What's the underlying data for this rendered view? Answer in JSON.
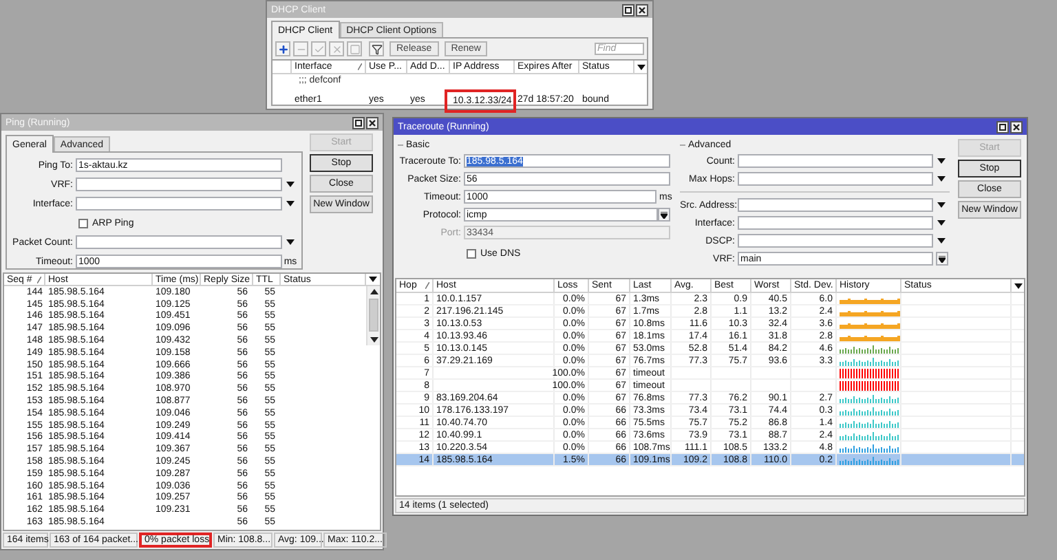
{
  "dhcp_window": {
    "title": "DHCP Client",
    "active": false,
    "tabs": [
      {
        "label": "DHCP Client",
        "selected": true
      },
      {
        "label": "DHCP Client Options",
        "selected": false
      }
    ],
    "toolbar": [
      {
        "kind": "add",
        "disabled": false
      },
      {
        "kind": "remove",
        "disabled": true
      },
      {
        "kind": "enable",
        "disabled": true
      },
      {
        "kind": "disable",
        "disabled": true
      },
      {
        "kind": "comment",
        "disabled": true
      },
      {
        "kind": "filter",
        "disabled": false
      }
    ],
    "actions": [
      {
        "label": "Release",
        "disabled": false
      },
      {
        "label": "Renew",
        "disabled": false
      }
    ],
    "find": {
      "placeholder": "Find"
    },
    "columns": [
      {
        "label": "Interface",
        "sorted": true
      },
      {
        "label": "Use P...",
        "sorted": false
      },
      {
        "label": "Add D...",
        "sorted": false
      },
      {
        "label": "IP Address",
        "sorted": false
      },
      {
        "label": "Expires After",
        "sorted": false
      },
      {
        "label": "Status",
        "sorted": false
      }
    ],
    "rows": [
      {
        "kind": "comment",
        "text": ";;; defconf"
      },
      {
        "kind": "entry",
        "cells": [
          {
            "text": "ether1",
            "highlighted": false
          },
          {
            "text": "yes",
            "highlighted": false
          },
          {
            "text": "yes",
            "highlighted": false
          },
          {
            "text": "10.3.12.33/24",
            "highlighted": true
          },
          {
            "text": "27d 18:57:20",
            "highlighted": false
          },
          {
            "text": "bound",
            "highlighted": false
          }
        ]
      }
    ]
  },
  "ping_window": {
    "title": "Ping (Running)",
    "active": false,
    "tabs": [
      {
        "label": "General",
        "selected": true
      },
      {
        "label": "Advanced",
        "selected": false
      }
    ],
    "form": [
      {
        "kind": "text",
        "label": "Ping To:",
        "value": "1s-aktau.kz"
      },
      {
        "kind": "dropdown",
        "label": "VRF:"
      },
      {
        "kind": "dropdown",
        "label": "Interface:"
      },
      {
        "kind": "checkbox",
        "label": "ARP Ping",
        "checked": false
      },
      {
        "kind": "dropdown",
        "label": "Packet Count:"
      },
      {
        "kind": "text",
        "label": "Timeout:",
        "value": "1000",
        "unit": "ms"
      }
    ],
    "buttons": [
      {
        "label": "Start",
        "disabled": true,
        "default": false
      },
      {
        "label": "Stop",
        "disabled": false,
        "default": true
      },
      {
        "label": "Close",
        "disabled": false,
        "default": false
      },
      {
        "label": "New Window",
        "disabled": false,
        "default": false
      }
    ],
    "columns": [
      {
        "label": "Seq #",
        "sorted": true
      },
      {
        "label": "Host",
        "sorted": false
      },
      {
        "label": "Time (ms)",
        "sorted": false
      },
      {
        "label": "Reply Size",
        "sorted": false
      },
      {
        "label": "TTL",
        "sorted": false
      },
      {
        "label": "Status",
        "sorted": false
      }
    ],
    "rows": [
      {
        "seq": "144",
        "host": "185.98.5.164",
        "time": "109.180",
        "reply_size": "56",
        "ttl": "55"
      },
      {
        "seq": "145",
        "host": "185.98.5.164",
        "time": "109.125",
        "reply_size": "56",
        "ttl": "55"
      },
      {
        "seq": "146",
        "host": "185.98.5.164",
        "time": "109.451",
        "reply_size": "56",
        "ttl": "55"
      },
      {
        "seq": "147",
        "host": "185.98.5.164",
        "time": "109.096",
        "reply_size": "56",
        "ttl": "55"
      },
      {
        "seq": "148",
        "host": "185.98.5.164",
        "time": "109.432",
        "reply_size": "56",
        "ttl": "55"
      },
      {
        "seq": "149",
        "host": "185.98.5.164",
        "time": "109.158",
        "reply_size": "56",
        "ttl": "55"
      },
      {
        "seq": "150",
        "host": "185.98.5.164",
        "time": "109.666",
        "reply_size": "56",
        "ttl": "55"
      },
      {
        "seq": "151",
        "host": "185.98.5.164",
        "time": "109.386",
        "reply_size": "56",
        "ttl": "55"
      },
      {
        "seq": "152",
        "host": "185.98.5.164",
        "time": "108.970",
        "reply_size": "56",
        "ttl": "55"
      },
      {
        "seq": "153",
        "host": "185.98.5.164",
        "time": "108.877",
        "reply_size": "56",
        "ttl": "55"
      },
      {
        "seq": "154",
        "host": "185.98.5.164",
        "time": "109.046",
        "reply_size": "56",
        "ttl": "55"
      },
      {
        "seq": "155",
        "host": "185.98.5.164",
        "time": "109.249",
        "reply_size": "56",
        "ttl": "55"
      },
      {
        "seq": "156",
        "host": "185.98.5.164",
        "time": "109.414",
        "reply_size": "56",
        "ttl": "55"
      },
      {
        "seq": "157",
        "host": "185.98.5.164",
        "time": "109.367",
        "reply_size": "56",
        "ttl": "55"
      },
      {
        "seq": "158",
        "host": "185.98.5.164",
        "time": "109.245",
        "reply_size": "56",
        "ttl": "55"
      },
      {
        "seq": "159",
        "host": "185.98.5.164",
        "time": "109.287",
        "reply_size": "56",
        "ttl": "55"
      },
      {
        "seq": "160",
        "host": "185.98.5.164",
        "time": "109.036",
        "reply_size": "56",
        "ttl": "55"
      },
      {
        "seq": "161",
        "host": "185.98.5.164",
        "time": "109.257",
        "reply_size": "56",
        "ttl": "55"
      },
      {
        "seq": "162",
        "host": "185.98.5.164",
        "time": "109.231",
        "reply_size": "56",
        "ttl": "55"
      },
      {
        "seq": "163",
        "host": "185.98.5.164",
        "reply_size": "56",
        "ttl": "55"
      }
    ],
    "status_bar": [
      {
        "text": "164 items",
        "highlighted": false
      },
      {
        "text": "163 of 164 packet...",
        "highlighted": false
      },
      {
        "text": "0% packet loss",
        "highlighted": true
      },
      {
        "text": "Min: 108.8...",
        "highlighted": false
      },
      {
        "text": "Avg: 109...",
        "highlighted": false
      },
      {
        "text": "Max: 110.2...",
        "highlighted": false
      }
    ]
  },
  "traceroute_window": {
    "title": "Traceroute (Running)",
    "active": true,
    "basic": {
      "label": "Basic",
      "fields": [
        {
          "kind": "text",
          "label": "Traceroute To:",
          "value": "185.98.5.164",
          "value_selected": true,
          "disabled": false
        },
        {
          "kind": "text",
          "label": "Packet Size:",
          "value": "56",
          "value_selected": false,
          "disabled": false
        },
        {
          "kind": "text",
          "label": "Timeout:",
          "value": "1000",
          "unit": "ms",
          "value_selected": false,
          "disabled": false
        },
        {
          "kind": "select",
          "label": "Protocol:",
          "value": "icmp",
          "disabled": false
        },
        {
          "kind": "text",
          "label": "Port:",
          "value": "33434",
          "value_selected": false,
          "disabled": true
        },
        {
          "kind": "checkbox",
          "label": "Use DNS",
          "checked": false
        }
      ]
    },
    "advanced": {
      "label": "Advanced",
      "fields": [
        {
          "kind": "dropdown",
          "label": "Count:"
        },
        {
          "kind": "dropdown",
          "label": "Max Hops:"
        },
        {
          "kind": "separator"
        },
        {
          "kind": "dropdown",
          "label": "Src. Address:"
        },
        {
          "kind": "dropdown",
          "label": "Interface:"
        },
        {
          "kind": "dropdown",
          "label": "DSCP:"
        },
        {
          "kind": "select",
          "label": "VRF:",
          "value": "main"
        }
      ]
    },
    "buttons": [
      {
        "label": "Start",
        "disabled": true,
        "default": false
      },
      {
        "label": "Stop",
        "disabled": false,
        "default": true
      },
      {
        "label": "Close",
        "disabled": false,
        "default": false
      },
      {
        "label": "New Window",
        "disabled": false,
        "default": false
      }
    ],
    "columns": [
      {
        "label": "Hop",
        "sorted": true
      },
      {
        "label": "Host",
        "sorted": false
      },
      {
        "label": "Loss",
        "sorted": false
      },
      {
        "label": "Sent",
        "sorted": false
      },
      {
        "label": "Last",
        "sorted": false
      },
      {
        "label": "Avg.",
        "sorted": false
      },
      {
        "label": "Best",
        "sorted": false
      },
      {
        "label": "Worst",
        "sorted": false
      },
      {
        "label": "Std. Dev.",
        "sorted": false
      },
      {
        "label": "History",
        "sorted": false
      },
      {
        "label": "Status",
        "sorted": false
      }
    ],
    "hops": [
      {
        "hop": "1",
        "host": "10.0.1.157",
        "loss": "0.0%",
        "sent": "67",
        "last": "1.3ms",
        "avg": "2.3",
        "best": "0.9",
        "worst": "40.5",
        "std_dev": "6.0",
        "color": "#f5a623",
        "kind": "line",
        "selected": false
      },
      {
        "hop": "2",
        "host": "217.196.21.145",
        "loss": "0.0%",
        "sent": "67",
        "last": "1.7ms",
        "avg": "2.8",
        "best": "1.1",
        "worst": "13.2",
        "std_dev": "2.4",
        "color": "#f5a623",
        "kind": "line",
        "selected": false
      },
      {
        "hop": "3",
        "host": "10.13.0.53",
        "loss": "0.0%",
        "sent": "67",
        "last": "10.8ms",
        "avg": "11.6",
        "best": "10.3",
        "worst": "32.4",
        "std_dev": "3.6",
        "color": "#f5a623",
        "kind": "line",
        "selected": false
      },
      {
        "hop": "4",
        "host": "10.13.93.46",
        "loss": "0.0%",
        "sent": "67",
        "last": "18.1ms",
        "avg": "17.4",
        "best": "16.1",
        "worst": "31.8",
        "std_dev": "2.8",
        "color": "#f5a623",
        "kind": "line",
        "selected": false
      },
      {
        "hop": "5",
        "host": "10.13.0.145",
        "loss": "0.0%",
        "sent": "67",
        "last": "53.0ms",
        "avg": "52.8",
        "best": "51.4",
        "worst": "84.2",
        "std_dev": "4.6",
        "color": "#6aa84f",
        "kind": "bars",
        "selected": false
      },
      {
        "hop": "6",
        "host": "37.29.21.169",
        "loss": "0.0%",
        "sent": "67",
        "last": "76.7ms",
        "avg": "77.3",
        "best": "75.7",
        "worst": "93.6",
        "std_dev": "3.3",
        "color": "#3cc8c8",
        "kind": "bars",
        "selected": false
      },
      {
        "hop": "7",
        "loss": "100.0%",
        "sent": "67",
        "last": "timeout",
        "color": "#ff0000",
        "kind": "full",
        "selected": false
      },
      {
        "hop": "8",
        "loss": "100.0%",
        "sent": "67",
        "last": "timeout",
        "color": "#ff0000",
        "kind": "full",
        "selected": false
      },
      {
        "hop": "9",
        "host": "83.169.204.64",
        "loss": "0.0%",
        "sent": "67",
        "last": "76.8ms",
        "avg": "77.3",
        "best": "76.2",
        "worst": "90.1",
        "std_dev": "2.7",
        "color": "#3cc8c8",
        "kind": "bars",
        "selected": false
      },
      {
        "hop": "10",
        "host": "178.176.133.197",
        "loss": "0.0%",
        "sent": "66",
        "last": "73.3ms",
        "avg": "73.4",
        "best": "73.1",
        "worst": "74.4",
        "std_dev": "0.3",
        "color": "#3cc8c8",
        "kind": "bars",
        "selected": false
      },
      {
        "hop": "11",
        "host": "10.40.74.70",
        "loss": "0.0%",
        "sent": "66",
        "last": "75.5ms",
        "avg": "75.7",
        "best": "75.2",
        "worst": "86.8",
        "std_dev": "1.4",
        "color": "#3cc8c8",
        "kind": "bars",
        "selected": false
      },
      {
        "hop": "12",
        "host": "10.40.99.1",
        "loss": "0.0%",
        "sent": "66",
        "last": "73.6ms",
        "avg": "73.9",
        "best": "73.1",
        "worst": "88.7",
        "std_dev": "2.4",
        "color": "#3cc8c8",
        "kind": "bars",
        "selected": false
      },
      {
        "hop": "13",
        "host": "10.220.3.54",
        "loss": "0.0%",
        "sent": "66",
        "last": "108.7ms",
        "avg": "111.1",
        "best": "108.5",
        "worst": "133.2",
        "std_dev": "4.8",
        "color": "#30a0e0",
        "kind": "bars",
        "selected": false
      },
      {
        "hop": "14",
        "host": "185.98.5.164",
        "loss": "1.5%",
        "sent": "66",
        "last": "109.1ms",
        "avg": "109.2",
        "best": "108.8",
        "worst": "110.0",
        "std_dev": "0.2",
        "color": "#30a0e0",
        "kind": "bars",
        "selected": true
      }
    ],
    "status_bar": "14 items (1 selected)"
  }
}
